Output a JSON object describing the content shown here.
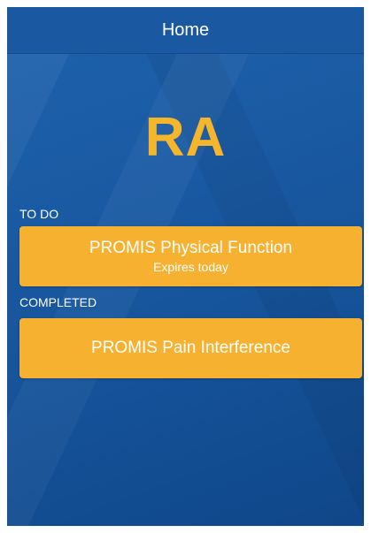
{
  "header": {
    "title": "Home"
  },
  "logo": {
    "text": "RA"
  },
  "todo": {
    "label": "TO DO",
    "items": [
      {
        "title": "PROMIS Physical Function",
        "subtitle": "Expires today"
      }
    ]
  },
  "completed": {
    "label": "COMPLETED",
    "items": [
      {
        "title": "PROMIS Pain Interference"
      }
    ]
  },
  "colors": {
    "background_blue": "#1a5aa3",
    "accent_orange": "#f7b130",
    "logo_yellow": "#f5b62b"
  }
}
